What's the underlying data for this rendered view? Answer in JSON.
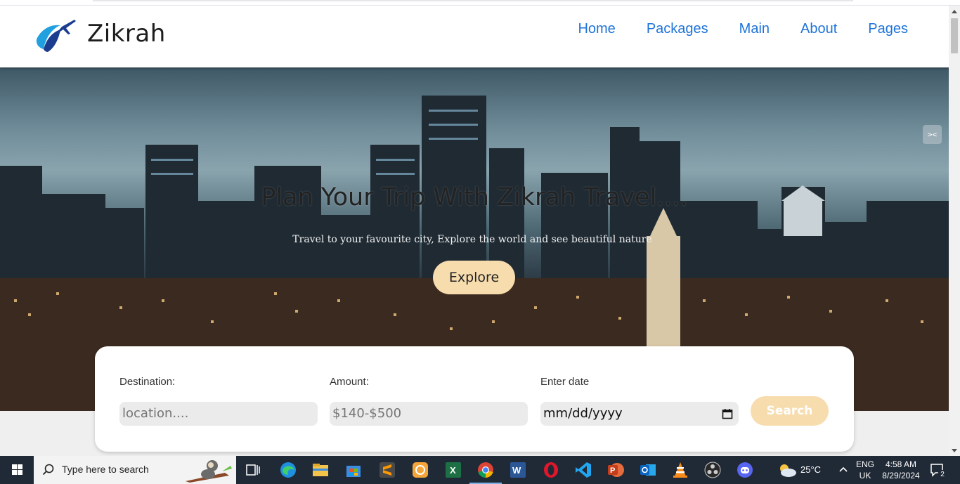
{
  "nav": {
    "brand": "Zikrah",
    "links": [
      "Home",
      "Packages",
      "Main",
      "About",
      "Pages"
    ]
  },
  "hero": {
    "title": "Plan Your Trip With Zikrah Travel....",
    "subtitle": "Travel to your favourite city, Explore the world and see beautiful nature",
    "explore_label": "Explore",
    "collapse_icon": "><"
  },
  "search": {
    "destination_label": "Destination:",
    "destination_placeholder": "location....",
    "amount_label": "Amount:",
    "amount_placeholder": "$140-$500",
    "date_label": "Enter date",
    "date_value": "mm/dd/yyyy",
    "button_label": "Search"
  },
  "taskbar": {
    "search_placeholder": "Type here to search",
    "weather": "25°C",
    "lang_top": "ENG",
    "lang_bottom": "UK",
    "time": "4:58 AM",
    "date": "8/29/2024",
    "notifications": "2",
    "apps": [
      "task-view-icon",
      "edge-icon",
      "file-explorer-icon",
      "store-icon",
      "sublime-icon",
      "cleanup-icon",
      "excel-icon",
      "chrome-icon",
      "word-icon",
      "opera-icon",
      "vscode-icon",
      "powerpoint-icon",
      "outlook-icon",
      "vlc-icon",
      "obs-icon",
      "discord-icon"
    ]
  },
  "colors": {
    "nav_link": "#1e73d8",
    "button_bg": "#f7dcae",
    "taskbar": "#202a36"
  }
}
